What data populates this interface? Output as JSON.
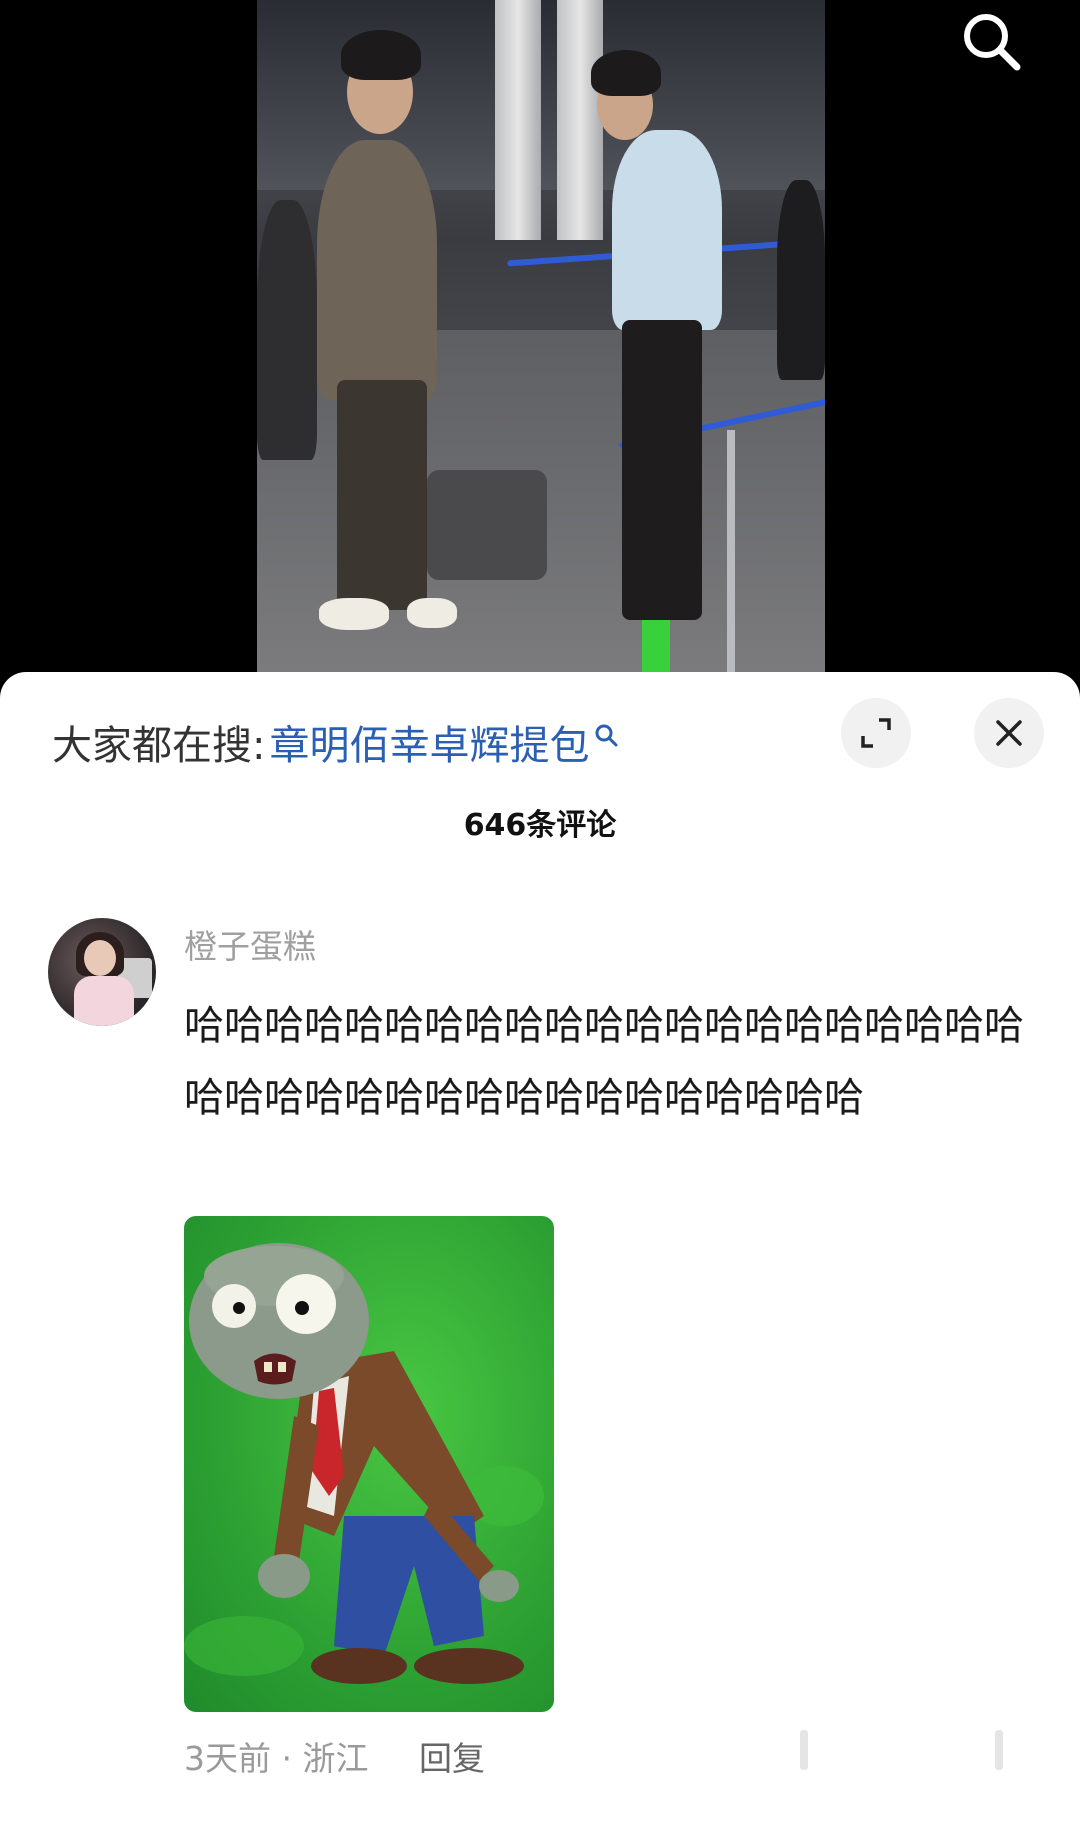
{
  "hot_search": {
    "prefix": "大家都在搜:",
    "term": "章明佰幸卓辉提包"
  },
  "comment_count": "646条评论",
  "comment": {
    "username": "橙子蛋糕",
    "text": "哈哈哈哈哈哈哈哈哈哈哈哈哈哈哈哈哈哈哈哈哈哈哈哈哈哈哈哈哈哈哈哈哈哈哈哈哈哈",
    "meta": "3天前 · 浙江",
    "reply_label": "回复"
  },
  "icons": {
    "search": "search-icon",
    "expand": "expand-icon",
    "close": "close-icon"
  },
  "colors": {
    "hot_term": "#2b5fb3",
    "username": "#a0a0a0",
    "sheet_bg": "#ffffff"
  }
}
